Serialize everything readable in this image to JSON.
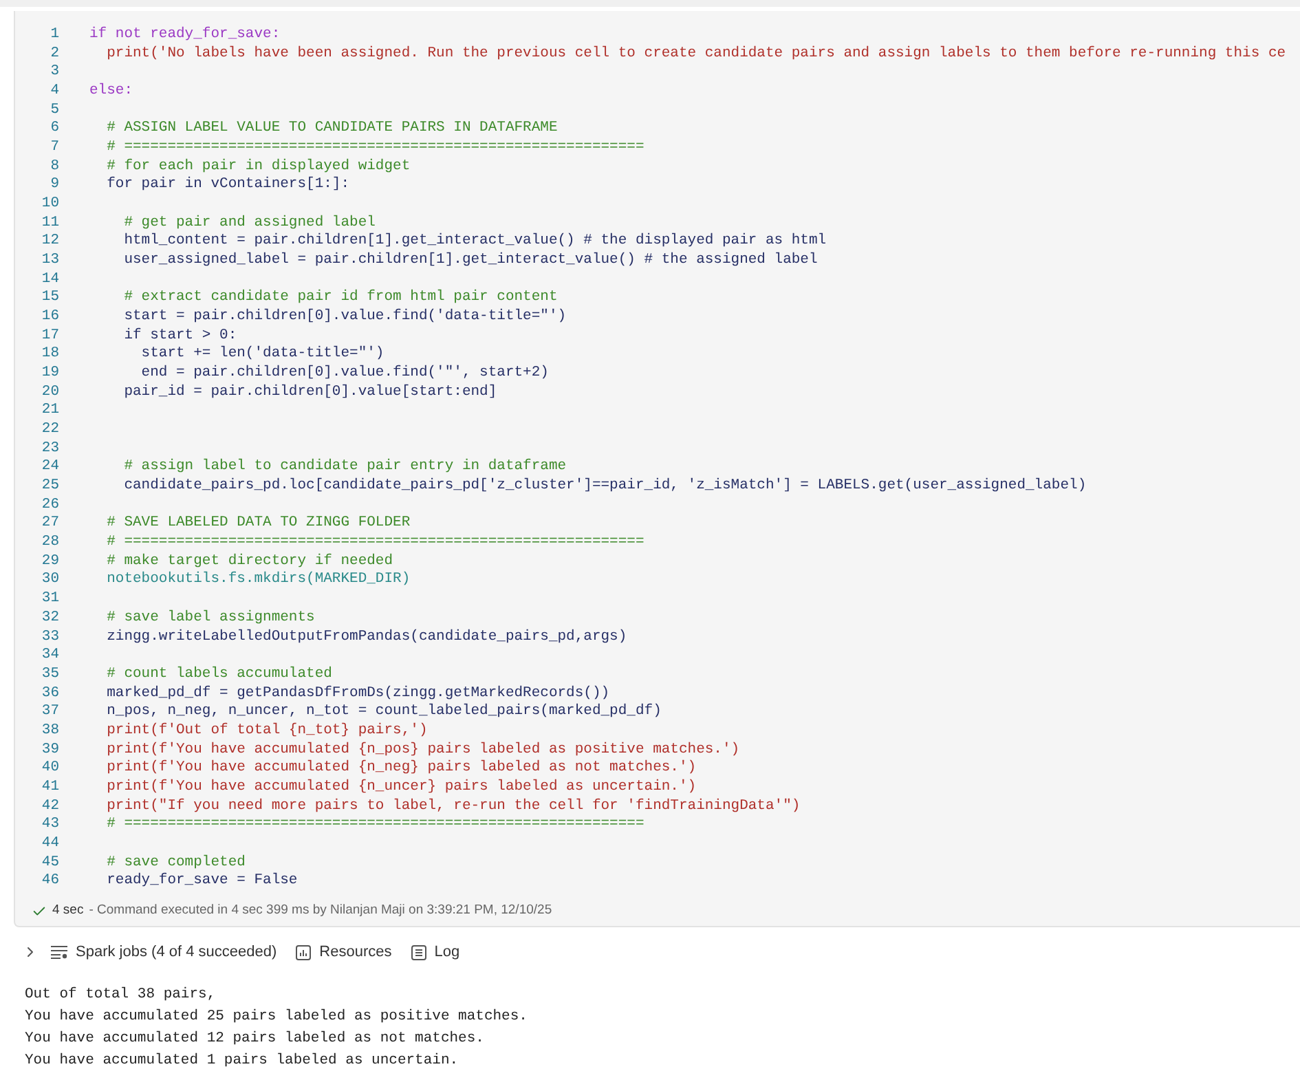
{
  "cell": {
    "lines": [
      {
        "number": "1",
        "kind": "keyword",
        "text": "if not ready_for_save:"
      },
      {
        "number": "2",
        "kind": "string",
        "text": "  print('No labels have been assigned. Run the previous cell to create candidate pairs and assign labels to them before re-running this ce"
      },
      {
        "number": "3"
      },
      {
        "number": "4",
        "kind": "keyword",
        "text": "else:"
      },
      {
        "number": "5"
      },
      {
        "number": "6",
        "kind": "comment",
        "text": "  # ASSIGN LABEL VALUE TO CANDIDATE PAIRS IN DATAFRAME"
      },
      {
        "number": "7",
        "kind": "comment",
        "text": "  # ============================================================"
      },
      {
        "number": "8",
        "kind": "comment",
        "text": "  # for each pair in displayed widget"
      },
      {
        "number": "9",
        "kind": "code",
        "text": "  for pair in vContainers[1:]:"
      },
      {
        "number": "10"
      },
      {
        "number": "11",
        "kind": "comment",
        "text": "    # get pair and assigned label"
      },
      {
        "number": "12",
        "kind": "code",
        "text": "    html_content = pair.children[1].get_interact_value() # the displayed pair as html"
      },
      {
        "number": "13",
        "kind": "code",
        "text": "    user_assigned_label = pair.children[1].get_interact_value() # the assigned label"
      },
      {
        "number": "14"
      },
      {
        "number": "15",
        "kind": "comment",
        "text": "    # extract candidate pair id from html pair content"
      },
      {
        "number": "16",
        "kind": "code",
        "text": "    start = pair.children[0].value.find('data-title=\"')"
      },
      {
        "number": "17",
        "kind": "code",
        "text": "    if start > 0:"
      },
      {
        "number": "18",
        "kind": "code",
        "text": "      start += len('data-title=\"')"
      },
      {
        "number": "19",
        "kind": "code",
        "text": "      end = pair.children[0].value.find('\"', start+2)"
      },
      {
        "number": "20",
        "kind": "code",
        "text": "    pair_id = pair.children[0].value[start:end]"
      },
      {
        "number": "21"
      },
      {
        "number": "22"
      },
      {
        "number": "23"
      },
      {
        "number": "24",
        "kind": "comment",
        "text": "    # assign label to candidate pair entry in dataframe"
      },
      {
        "number": "25",
        "kind": "code",
        "text": "    candidate_pairs_pd.loc[candidate_pairs_pd['z_cluster']==pair_id, 'z_isMatch'] = LABELS.get(user_assigned_label)"
      },
      {
        "number": "26"
      },
      {
        "number": "27",
        "kind": "comment",
        "text": "  # SAVE LABELED DATA TO ZINGG FOLDER"
      },
      {
        "number": "28",
        "kind": "comment",
        "text": "  # ============================================================"
      },
      {
        "number": "29",
        "kind": "comment",
        "text": "  # make target directory if needed"
      },
      {
        "number": "30",
        "kind": "module",
        "text": "  notebookutils.fs.mkdirs(MARKED_DIR)"
      },
      {
        "number": "31"
      },
      {
        "number": "32",
        "kind": "comment",
        "text": "  # save label assignments"
      },
      {
        "number": "33",
        "kind": "code",
        "text": "  zingg.writeLabelledOutputFromPandas(candidate_pairs_pd,args)"
      },
      {
        "number": "34"
      },
      {
        "number": "35",
        "kind": "comment",
        "text": "  # count labels accumulated"
      },
      {
        "number": "36",
        "kind": "code",
        "text": "  marked_pd_df = getPandasDfFromDs(zingg.getMarkedRecords())"
      },
      {
        "number": "37",
        "kind": "code",
        "text": "  n_pos, n_neg, n_uncer, n_tot = count_labeled_pairs(marked_pd_df)"
      },
      {
        "number": "38",
        "kind": "string",
        "text": "  print(f'Out of total {n_tot} pairs,')"
      },
      {
        "number": "39",
        "kind": "string",
        "text": "  print(f'You have accumulated {n_pos} pairs labeled as positive matches.')"
      },
      {
        "number": "40",
        "kind": "string",
        "text": "  print(f'You have accumulated {n_neg} pairs labeled as not matches.')"
      },
      {
        "number": "41",
        "kind": "string",
        "text": "  print(f'You have accumulated {n_uncer} pairs labeled as uncertain.')"
      },
      {
        "number": "42",
        "kind": "string",
        "text": "  print(\"If you need more pairs to label, re-run the cell for 'findTrainingData'\")"
      },
      {
        "number": "43",
        "kind": "comment",
        "text": "  # ============================================================"
      },
      {
        "number": "44"
      },
      {
        "number": "45",
        "kind": "comment",
        "text": "  # save completed"
      },
      {
        "number": "46",
        "kind": "code",
        "text": "  ready_for_save = False"
      }
    ],
    "status": {
      "duration": "4 sec",
      "detail": "- Command executed in 4 sec 399 ms by Nilanjan Maji on 3:39:21 PM, 12/10/25"
    }
  },
  "toolbar": {
    "expanded": false,
    "items": [
      {
        "kind": "jobs",
        "label": "Spark jobs (4 of 4 succeeded)"
      },
      {
        "kind": "resources",
        "label": "Resources"
      },
      {
        "kind": "log",
        "label": "Log"
      }
    ]
  },
  "output": {
    "lines": [
      "Out of total 38 pairs,",
      "You have accumulated 25 pairs labeled as positive matches.",
      "You have accumulated 12 pairs labeled as not matches.",
      "You have accumulated 1 pairs labeled as uncertain."
    ]
  }
}
